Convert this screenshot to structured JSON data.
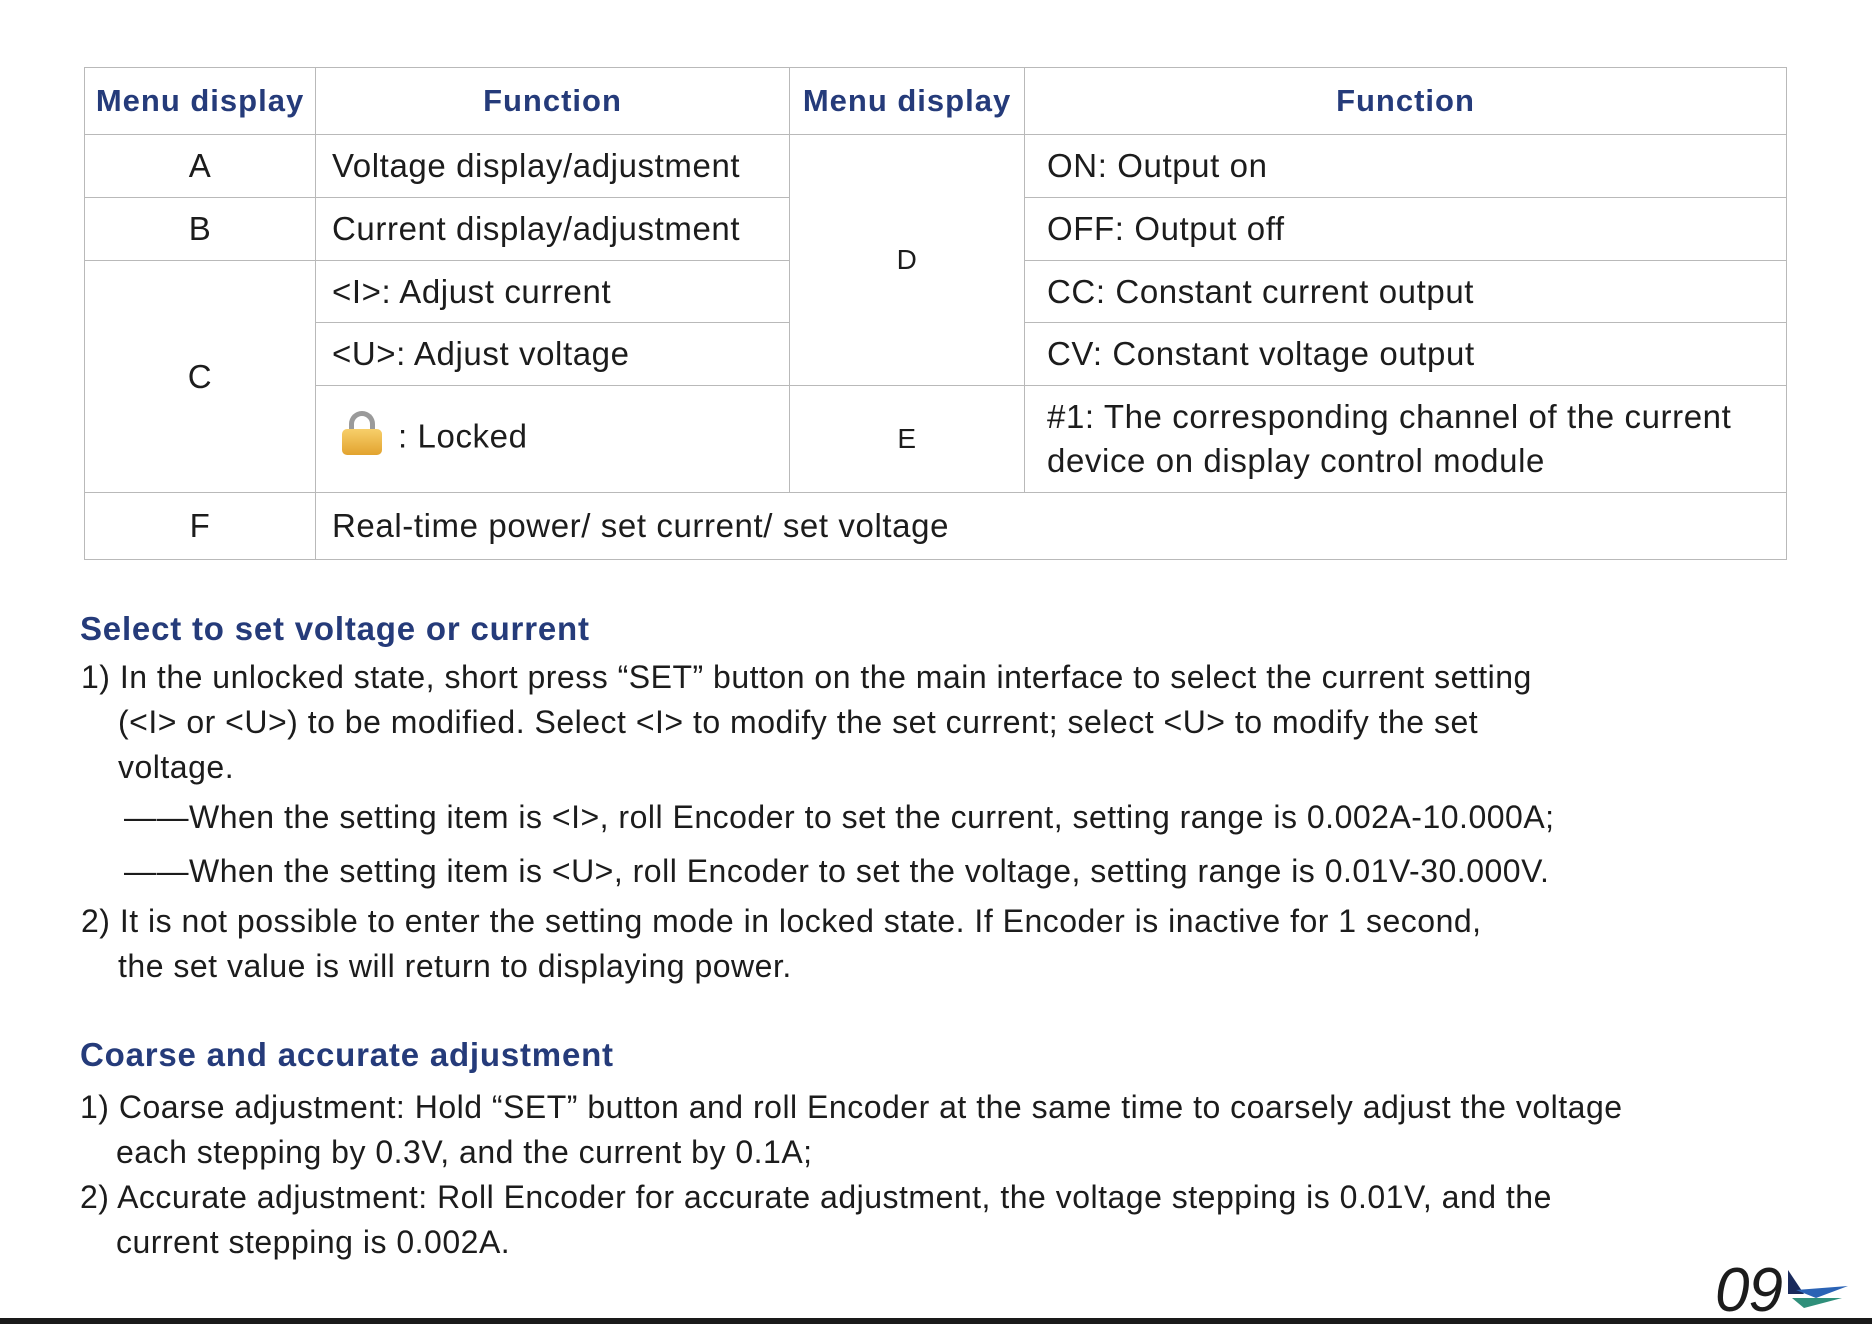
{
  "table": {
    "headers": [
      "Menu display",
      "Function",
      "Menu display",
      "Function"
    ],
    "rows": {
      "A": {
        "code": "A",
        "function": "Voltage display/adjustment"
      },
      "B": {
        "code": "B",
        "function": "Current display/adjustment"
      },
      "C": {
        "code": "C",
        "functions": [
          "<I>: Adjust current",
          "<U>: Adjust voltage",
          ": Locked"
        ],
        "lock_icon": "padlock-icon"
      },
      "D": {
        "code": "D",
        "functions": [
          "ON: Output on",
          "OFF: Output off",
          "CC: Constant current output",
          "CV: Constant voltage output"
        ]
      },
      "E": {
        "code": "E",
        "function_line1": "#1: The corresponding channel of the current",
        "function_line2": "device on display control module"
      },
      "F": {
        "code": "F",
        "function": "Real-time power/ set current/ set voltage"
      }
    }
  },
  "sections": {
    "select": {
      "heading": "Select to set voltage or current",
      "lines": [
        "1) In the unlocked state, short press “SET” button on the main interface to select the current setting",
        "(<I> or <U>) to be modified. Select <I> to modify the set current; select <U> to modify the set",
        "voltage.",
        "——When the setting item is <I>, roll Encoder to set the current, setting range is 0.002A-10.000A;",
        "——When the setting item is <U>, roll Encoder to set the voltage, setting range is 0.01V-30.000V.",
        "2) It is not possible to enter the setting mode in locked state. If Encoder is inactive for 1 second,",
        "the set value is will return to displaying power."
      ]
    },
    "coarse": {
      "heading": "Coarse and accurate adjustment",
      "lines": [
        "1) Coarse adjustment: Hold “SET” button and roll Encoder at the same time to coarsely adjust the voltage",
        "each stepping by 0.3V, and the current by 0.1A;",
        "2) Accurate adjustment: Roll Encoder for accurate adjustment, the voltage stepping is 0.01V, and the",
        "current stepping is 0.002A."
      ]
    }
  },
  "footer": {
    "page_number": "09",
    "logo_icon": "brand-triangle-logo-icon",
    "colors": {
      "heading": "#253b7a",
      "logo_blue": "#2b63b5",
      "logo_green": "#2f8f7a",
      "logo_dark": "#1a2a5c"
    }
  }
}
